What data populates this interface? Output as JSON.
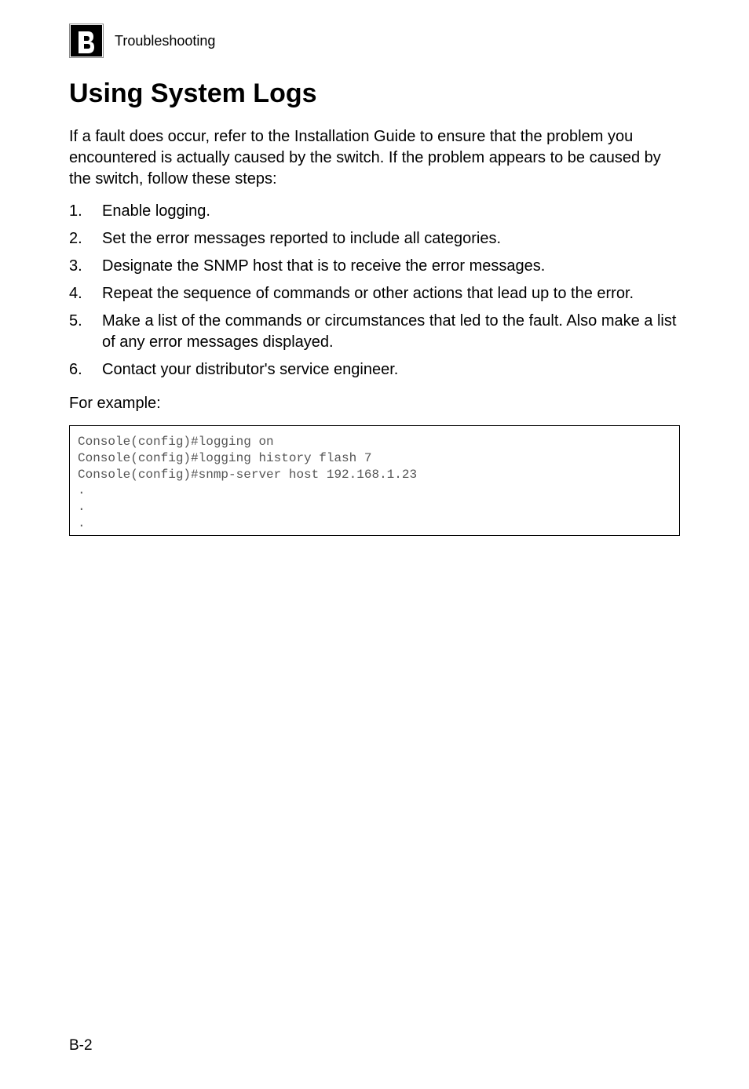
{
  "header": {
    "appendix_letter": "B",
    "label": "Troubleshooting"
  },
  "title": "Using System Logs",
  "intro": "If a fault does occur, refer to the Installation Guide to ensure that the problem you encountered is actually caused by the switch. If the problem appears to be caused by the switch, follow these steps:",
  "steps": [
    "Enable logging.",
    "Set the error messages reported to include all categories.",
    "Designate the SNMP host that is to receive the error messages.",
    "Repeat the sequence of commands or other actions that lead up to the error.",
    "Make a list of the commands or circumstances that led to the fault. Also make a list of any error messages displayed.",
    "Contact your distributor's service engineer."
  ],
  "example_lead": "For example:",
  "code": "Console(config)#logging on\nConsole(config)#logging history flash 7\nConsole(config)#snmp-server host 192.168.1.23\n.\n.\n.",
  "page_number": "B-2"
}
